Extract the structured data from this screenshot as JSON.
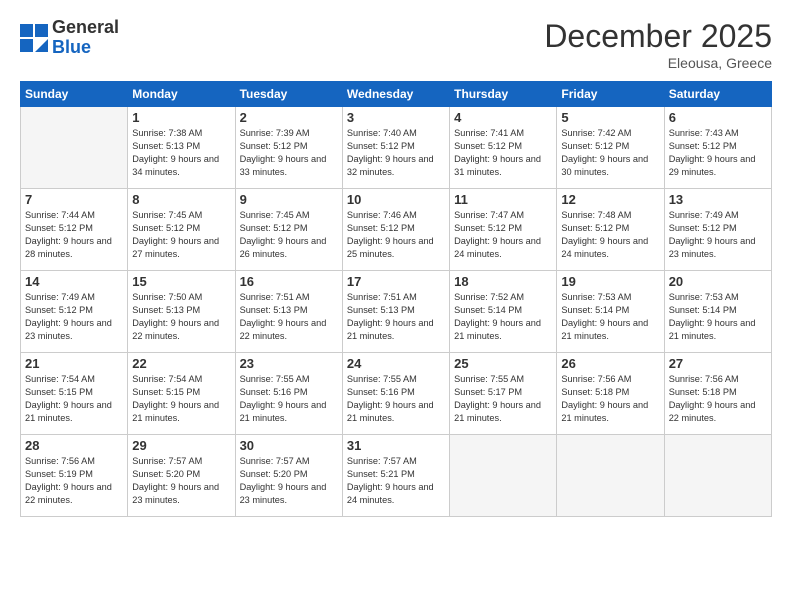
{
  "logo": {
    "general": "General",
    "blue": "Blue"
  },
  "header": {
    "month": "December 2025",
    "location": "Eleousa, Greece"
  },
  "weekdays": [
    "Sunday",
    "Monday",
    "Tuesday",
    "Wednesday",
    "Thursday",
    "Friday",
    "Saturday"
  ],
  "weeks": [
    [
      {
        "day": "",
        "empty": true
      },
      {
        "day": "1",
        "sunrise": "Sunrise: 7:38 AM",
        "sunset": "Sunset: 5:13 PM",
        "daylight": "Daylight: 9 hours and 34 minutes."
      },
      {
        "day": "2",
        "sunrise": "Sunrise: 7:39 AM",
        "sunset": "Sunset: 5:12 PM",
        "daylight": "Daylight: 9 hours and 33 minutes."
      },
      {
        "day": "3",
        "sunrise": "Sunrise: 7:40 AM",
        "sunset": "Sunset: 5:12 PM",
        "daylight": "Daylight: 9 hours and 32 minutes."
      },
      {
        "day": "4",
        "sunrise": "Sunrise: 7:41 AM",
        "sunset": "Sunset: 5:12 PM",
        "daylight": "Daylight: 9 hours and 31 minutes."
      },
      {
        "day": "5",
        "sunrise": "Sunrise: 7:42 AM",
        "sunset": "Sunset: 5:12 PM",
        "daylight": "Daylight: 9 hours and 30 minutes."
      },
      {
        "day": "6",
        "sunrise": "Sunrise: 7:43 AM",
        "sunset": "Sunset: 5:12 PM",
        "daylight": "Daylight: 9 hours and 29 minutes."
      }
    ],
    [
      {
        "day": "7",
        "sunrise": "Sunrise: 7:44 AM",
        "sunset": "Sunset: 5:12 PM",
        "daylight": "Daylight: 9 hours and 28 minutes."
      },
      {
        "day": "8",
        "sunrise": "Sunrise: 7:45 AM",
        "sunset": "Sunset: 5:12 PM",
        "daylight": "Daylight: 9 hours and 27 minutes."
      },
      {
        "day": "9",
        "sunrise": "Sunrise: 7:45 AM",
        "sunset": "Sunset: 5:12 PM",
        "daylight": "Daylight: 9 hours and 26 minutes."
      },
      {
        "day": "10",
        "sunrise": "Sunrise: 7:46 AM",
        "sunset": "Sunset: 5:12 PM",
        "daylight": "Daylight: 9 hours and 25 minutes."
      },
      {
        "day": "11",
        "sunrise": "Sunrise: 7:47 AM",
        "sunset": "Sunset: 5:12 PM",
        "daylight": "Daylight: 9 hours and 24 minutes."
      },
      {
        "day": "12",
        "sunrise": "Sunrise: 7:48 AM",
        "sunset": "Sunset: 5:12 PM",
        "daylight": "Daylight: 9 hours and 24 minutes."
      },
      {
        "day": "13",
        "sunrise": "Sunrise: 7:49 AM",
        "sunset": "Sunset: 5:12 PM",
        "daylight": "Daylight: 9 hours and 23 minutes."
      }
    ],
    [
      {
        "day": "14",
        "sunrise": "Sunrise: 7:49 AM",
        "sunset": "Sunset: 5:12 PM",
        "daylight": "Daylight: 9 hours and 23 minutes."
      },
      {
        "day": "15",
        "sunrise": "Sunrise: 7:50 AM",
        "sunset": "Sunset: 5:13 PM",
        "daylight": "Daylight: 9 hours and 22 minutes."
      },
      {
        "day": "16",
        "sunrise": "Sunrise: 7:51 AM",
        "sunset": "Sunset: 5:13 PM",
        "daylight": "Daylight: 9 hours and 22 minutes."
      },
      {
        "day": "17",
        "sunrise": "Sunrise: 7:51 AM",
        "sunset": "Sunset: 5:13 PM",
        "daylight": "Daylight: 9 hours and 21 minutes."
      },
      {
        "day": "18",
        "sunrise": "Sunrise: 7:52 AM",
        "sunset": "Sunset: 5:14 PM",
        "daylight": "Daylight: 9 hours and 21 minutes."
      },
      {
        "day": "19",
        "sunrise": "Sunrise: 7:53 AM",
        "sunset": "Sunset: 5:14 PM",
        "daylight": "Daylight: 9 hours and 21 minutes."
      },
      {
        "day": "20",
        "sunrise": "Sunrise: 7:53 AM",
        "sunset": "Sunset: 5:14 PM",
        "daylight": "Daylight: 9 hours and 21 minutes."
      }
    ],
    [
      {
        "day": "21",
        "sunrise": "Sunrise: 7:54 AM",
        "sunset": "Sunset: 5:15 PM",
        "daylight": "Daylight: 9 hours and 21 minutes."
      },
      {
        "day": "22",
        "sunrise": "Sunrise: 7:54 AM",
        "sunset": "Sunset: 5:15 PM",
        "daylight": "Daylight: 9 hours and 21 minutes."
      },
      {
        "day": "23",
        "sunrise": "Sunrise: 7:55 AM",
        "sunset": "Sunset: 5:16 PM",
        "daylight": "Daylight: 9 hours and 21 minutes."
      },
      {
        "day": "24",
        "sunrise": "Sunrise: 7:55 AM",
        "sunset": "Sunset: 5:16 PM",
        "daylight": "Daylight: 9 hours and 21 minutes."
      },
      {
        "day": "25",
        "sunrise": "Sunrise: 7:55 AM",
        "sunset": "Sunset: 5:17 PM",
        "daylight": "Daylight: 9 hours and 21 minutes."
      },
      {
        "day": "26",
        "sunrise": "Sunrise: 7:56 AM",
        "sunset": "Sunset: 5:18 PM",
        "daylight": "Daylight: 9 hours and 21 minutes."
      },
      {
        "day": "27",
        "sunrise": "Sunrise: 7:56 AM",
        "sunset": "Sunset: 5:18 PM",
        "daylight": "Daylight: 9 hours and 22 minutes."
      }
    ],
    [
      {
        "day": "28",
        "sunrise": "Sunrise: 7:56 AM",
        "sunset": "Sunset: 5:19 PM",
        "daylight": "Daylight: 9 hours and 22 minutes."
      },
      {
        "day": "29",
        "sunrise": "Sunrise: 7:57 AM",
        "sunset": "Sunset: 5:20 PM",
        "daylight": "Daylight: 9 hours and 23 minutes."
      },
      {
        "day": "30",
        "sunrise": "Sunrise: 7:57 AM",
        "sunset": "Sunset: 5:20 PM",
        "daylight": "Daylight: 9 hours and 23 minutes."
      },
      {
        "day": "31",
        "sunrise": "Sunrise: 7:57 AM",
        "sunset": "Sunset: 5:21 PM",
        "daylight": "Daylight: 9 hours and 24 minutes."
      },
      {
        "day": "",
        "empty": true
      },
      {
        "day": "",
        "empty": true
      },
      {
        "day": "",
        "empty": true
      }
    ]
  ]
}
